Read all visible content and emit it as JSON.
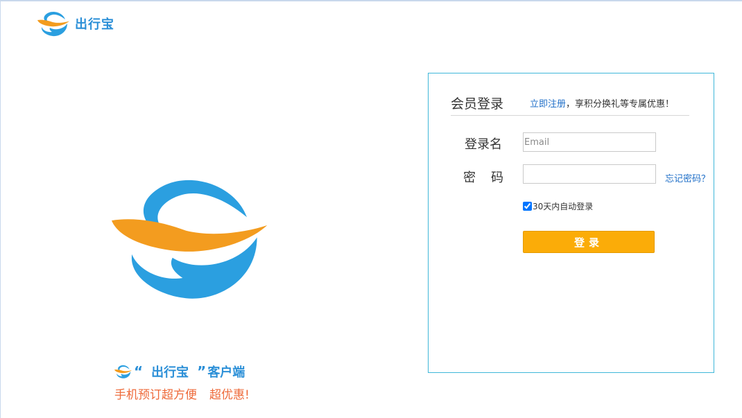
{
  "brand": {
    "name": "出行宝"
  },
  "promo": {
    "quote_open": "“",
    "brand": "出行宝",
    "quote_close": "”",
    "client": "客户端",
    "tagline_part1": "手机预订超方便",
    "tagline_part2": "超优惠!"
  },
  "login": {
    "title": "会员登录",
    "register_link": "立即注册",
    "benefit_text": "，享积分换礼等专属优惠！",
    "username_label": "登录名",
    "username_placeholder": "Email",
    "password_label": "密码",
    "forgot_link": "忘记密码？",
    "remember_label": "30天内自动登录",
    "remember_checked": true,
    "submit_label": "登录"
  },
  "colors": {
    "accent_blue": "#2b8fd7",
    "accent_orange": "#f39c1f",
    "button": "#fbac08",
    "border": "#3fb7d9",
    "link": "#2170c8",
    "promo_red": "#ee6a3a"
  },
  "icons": {
    "logo": "chuxingbao-logo-icon"
  }
}
